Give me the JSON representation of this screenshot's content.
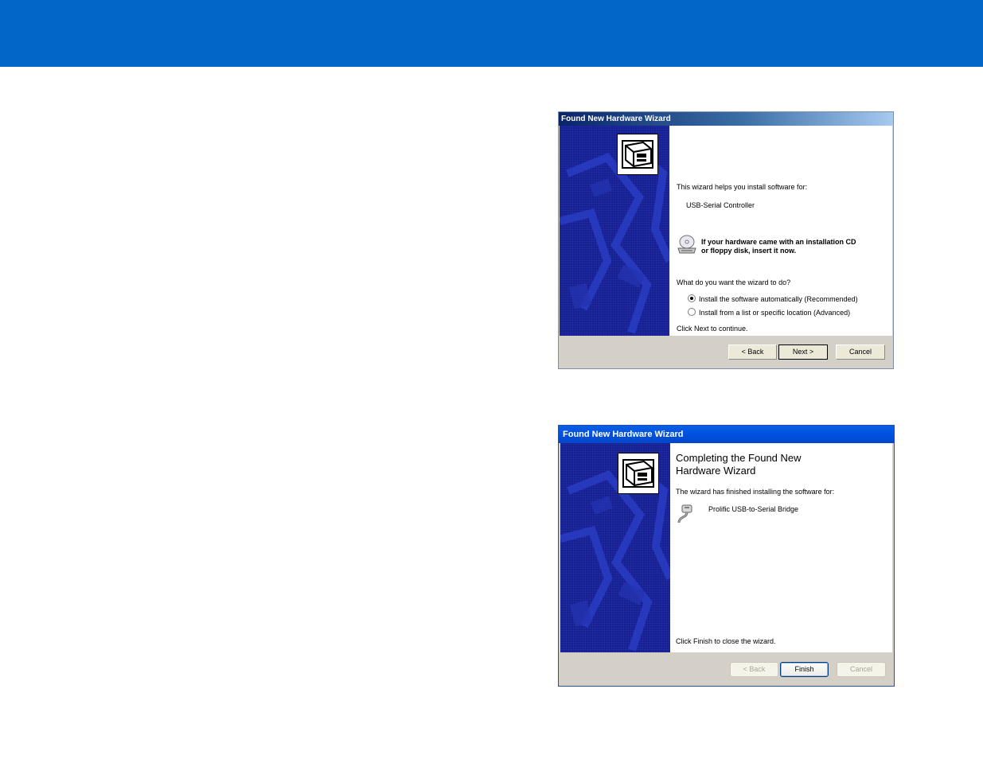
{
  "wizard1": {
    "title": "Found New Hardware Wizard",
    "intro": "This wizard helps you install software for:",
    "device": "USB-Serial Controller",
    "cd_notice_line1": "If your hardware came with an installation CD",
    "cd_notice_line2": "or floppy disk, insert it now.",
    "question": "What do you want the wizard to do?",
    "options": [
      {
        "label": "Install the software automatically (Recommended)",
        "selected": true
      },
      {
        "label": "Install from a list or specific location (Advanced)",
        "selected": false
      }
    ],
    "continue_text": "Click Next to continue.",
    "buttons": {
      "back": "< Back",
      "next": "Next >",
      "cancel": "Cancel"
    }
  },
  "wizard2": {
    "title": "Found New Hardware Wizard",
    "heading": "Completing the Found New\nHardware Wizard",
    "finished_text": "The wizard has finished installing the software for:",
    "device": "Prolific USB-to-Serial Bridge",
    "close_text": "Click Finish to close the wizard.",
    "buttons": {
      "back": "< Back",
      "finish": "Finish",
      "cancel": "Cancel"
    }
  },
  "colors": {
    "header_bar": "#0066c8",
    "side_panel": "#141c8c",
    "dialog_face": "#d4d0c8"
  }
}
